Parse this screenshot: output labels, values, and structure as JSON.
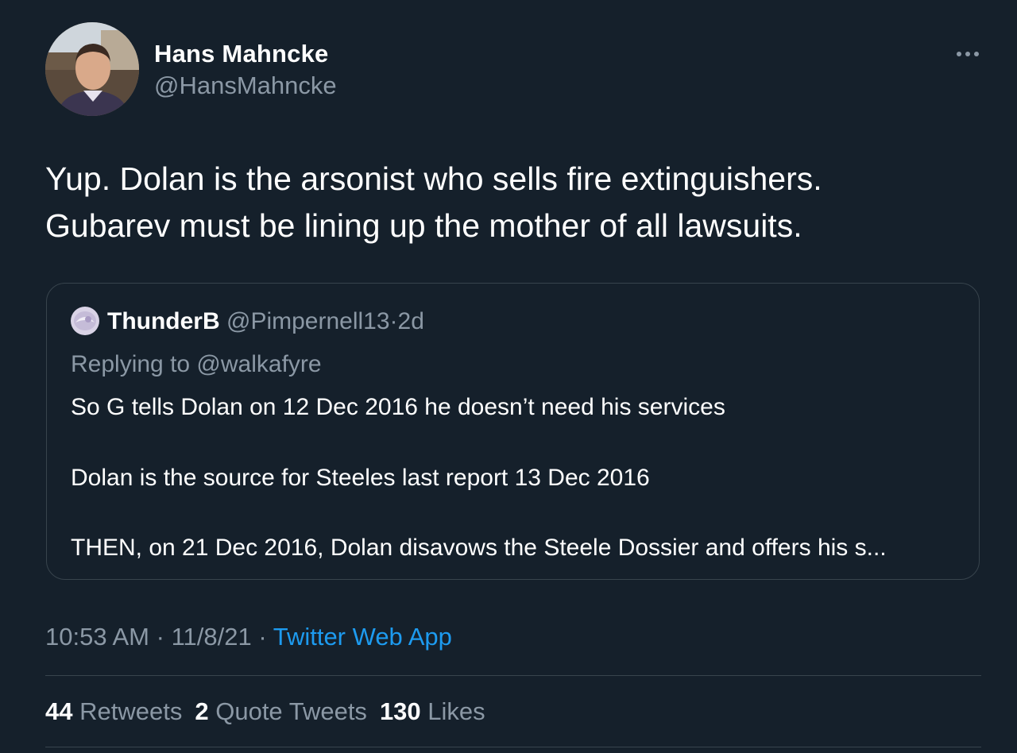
{
  "tweet": {
    "author": {
      "name": "Hans Mahncke",
      "handle": "@HansMahncke"
    },
    "text_lines": [
      "Yup. Dolan is the arsonist who sells fire extinguishers.",
      "Gubarev must be lining up the mother of all lawsuits."
    ],
    "quoted": {
      "name": "ThunderB",
      "handle": "@Pimpernell13",
      "separator": "·",
      "age": "2d",
      "replying_to": "Replying to @walkafyre",
      "lines": [
        "So G tells Dolan on 12 Dec 2016 he doesn’t need his services",
        "Dolan is the source for Steeles last report 13 Dec 2016",
        "THEN, on 21 Dec 2016, Dolan disavows the Steele Dossier and offers his s..."
      ]
    },
    "meta": {
      "time": "10:53 AM",
      "sep1": "·",
      "date": "11/8/21",
      "sep2": "·",
      "source": "Twitter Web App"
    },
    "stats": {
      "retweets_count": "44",
      "retweets_label": "Retweets",
      "quotes_count": "2",
      "quotes_label": "Quote Tweets",
      "likes_count": "130",
      "likes_label": "Likes"
    }
  },
  "colors": {
    "background": "#15202b",
    "primary_text": "#ffffff",
    "secondary_text": "#8b98a5",
    "link": "#1d9bf0",
    "border": "#38444d"
  },
  "icons": {
    "more": "more-horizontal-icon"
  }
}
